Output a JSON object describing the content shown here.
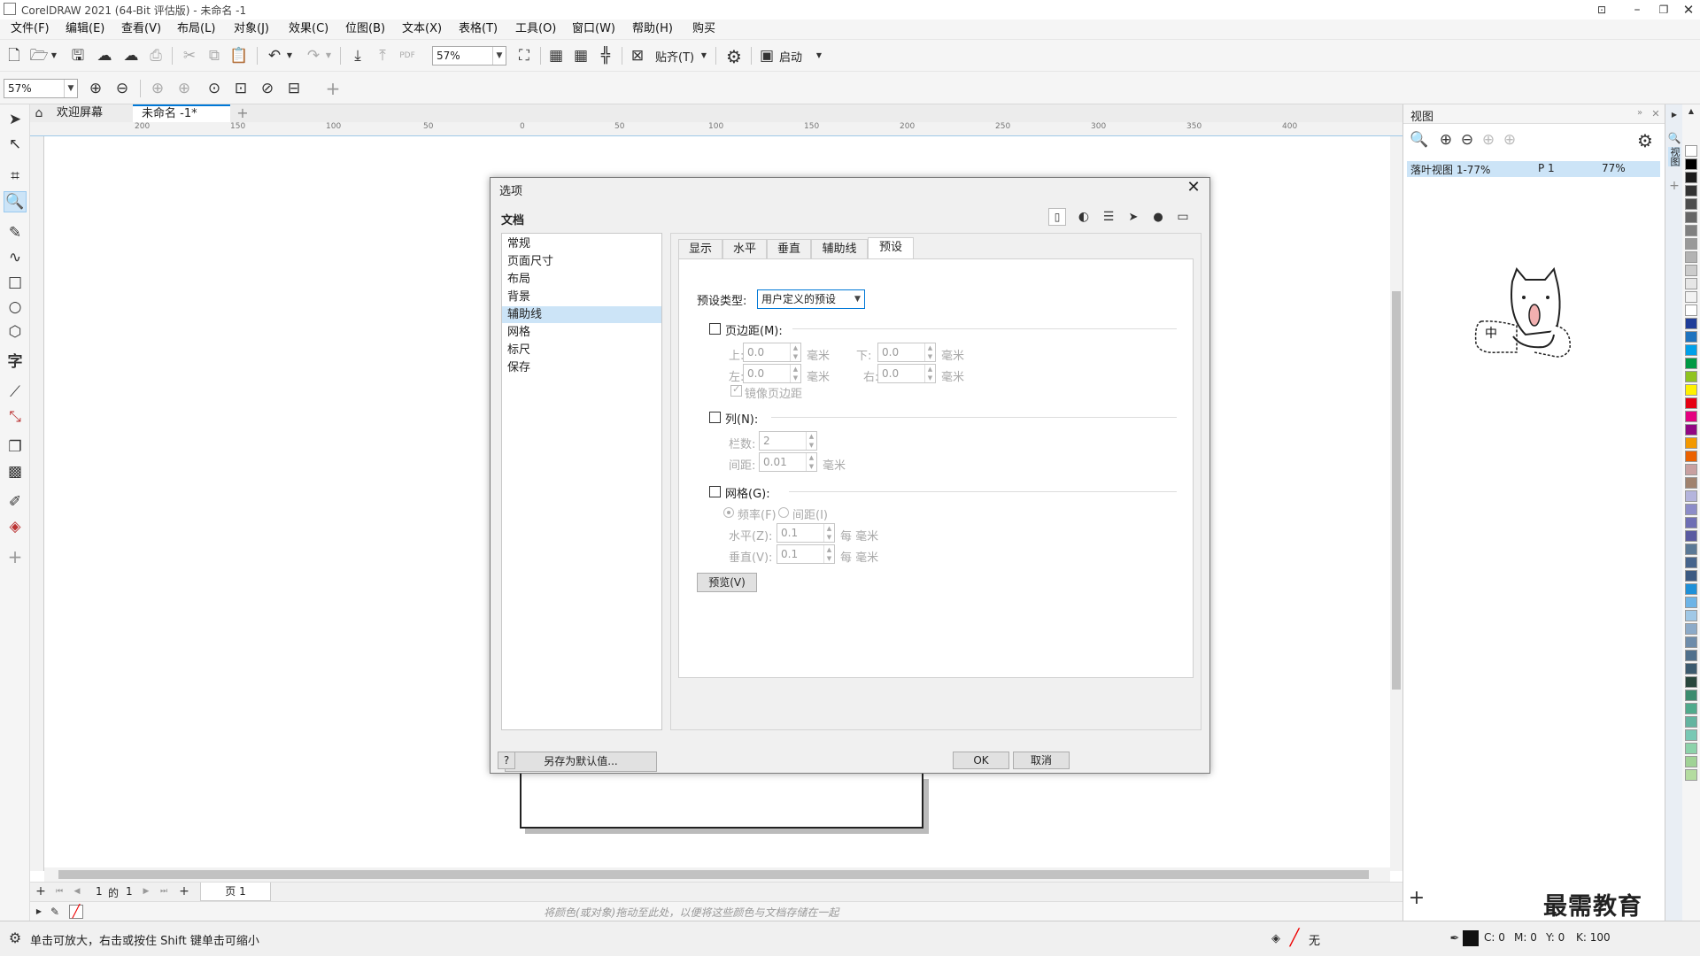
{
  "window": {
    "title": "CorelDRAW 2021 (64-Bit 评估版) - 未命名 -1"
  },
  "menu": [
    "文件(F)",
    "编辑(E)",
    "查看(V)",
    "布局(L)",
    "对象(J)",
    "效果(C)",
    "位图(B)",
    "文本(X)",
    "表格(T)",
    "工具(O)",
    "窗口(W)",
    "帮助(H)",
    "购买"
  ],
  "toolbar": {
    "zoom_value": "57%",
    "snap_label": "贴齐(T)",
    "launch_label": "启动"
  },
  "toolbar2": {
    "zoom_value": "57%"
  },
  "doc_tabs": {
    "welcome": "欢迎屏幕",
    "document": "未命名 -1*"
  },
  "ruler_h_labels": [
    "200",
    "150",
    "100",
    "50",
    "0",
    "50",
    "100",
    "150",
    "200",
    "250",
    "300",
    "350",
    "400"
  ],
  "page_nav": {
    "current": "1",
    "of": "的",
    "total": "1",
    "page_tab": "页 1"
  },
  "palette_hint": "将颜色(或对象)拖动至此处，以便将这些颜色与文档存储在一起",
  "status": {
    "hint": "单击可放大，右击或按住 Shift 键单击可缩小",
    "fill_none": "无",
    "cmyk_c": "C: 0",
    "cmyk_m": "M: 0",
    "cmyk_y": "Y: 0",
    "cmyk_k": "K: 100"
  },
  "dock": {
    "title": "视图",
    "list_item_name": "落叶视图 1-77%",
    "list_item_page": "P 1",
    "list_item_zoom": "77%",
    "tab_label": "视图"
  },
  "sticker_text": "中",
  "watermark": "最需教育",
  "dialog": {
    "title": "选项",
    "section": "文档",
    "tree": [
      "常规",
      "页面尺寸",
      "布局",
      "背景",
      "辅助线",
      "网格",
      "标尺",
      "保存"
    ],
    "tree_selected": "辅助线",
    "save_default": "另存为默认值...",
    "help": "?",
    "ok": "OK",
    "cancel": "取消",
    "tabs": [
      "显示",
      "水平",
      "垂直",
      "辅助线",
      "预设"
    ],
    "active_tab": "预设",
    "preset_type_label": "预设类型:",
    "preset_type_value": "用户定义的预设",
    "margins": {
      "label": "页边距(M):",
      "top_label": "上:",
      "top": "0.0",
      "bottom_label": "下:",
      "bottom": "0.0",
      "left_label": "左:",
      "left": "0.0",
      "right_label": "右:",
      "right": "0.0",
      "unit": "毫米",
      "mirror": "镜像页边距"
    },
    "columns": {
      "label": "列(N):",
      "count_label": "栏数:",
      "count": "2",
      "gap_label": "间距:",
      "gap": "0.01",
      "unit": "毫米"
    },
    "grid": {
      "label": "网格(G):",
      "freq": "频率(F)",
      "interval": "间距(I)",
      "h_label": "水平(Z):",
      "h": "0.1",
      "v_label": "垂直(V):",
      "v": "0.1",
      "unit": "每 毫米"
    },
    "preview": "预览(V)"
  },
  "colors": {
    "accent": "#0078d7",
    "selection": "#cce4f7",
    "swatches": [
      "#ffffff",
      "#000000",
      "#1a1a1a",
      "#333333",
      "#4d4d4d",
      "#666666",
      "#808080",
      "#999999",
      "#b3b3b3",
      "#cccccc",
      "#e6e6e6",
      "#f2f2f2",
      "#ffffff",
      "#1f3d99",
      "#1e73be",
      "#00a0e9",
      "#009944",
      "#8fc31f",
      "#fff100",
      "#e60012",
      "#e4007f",
      "#920783",
      "#f39800",
      "#eb6100",
      "#c8a0a0",
      "#a0826e",
      "#b4b4dc",
      "#8c8cc8",
      "#6e6eb4",
      "#5a5aa0",
      "#5a7896",
      "#46648c",
      "#3c5a82",
      "#1e90d8",
      "#6eb4e6",
      "#a0c8e6",
      "#8caac8",
      "#6e8caa",
      "#50708c",
      "#3c5a6e",
      "#28463c",
      "#3c8c6e",
      "#50aa8c",
      "#64b4a0",
      "#78c8b4",
      "#8cd2aa",
      "#a0d296",
      "#b4dca0"
    ]
  }
}
